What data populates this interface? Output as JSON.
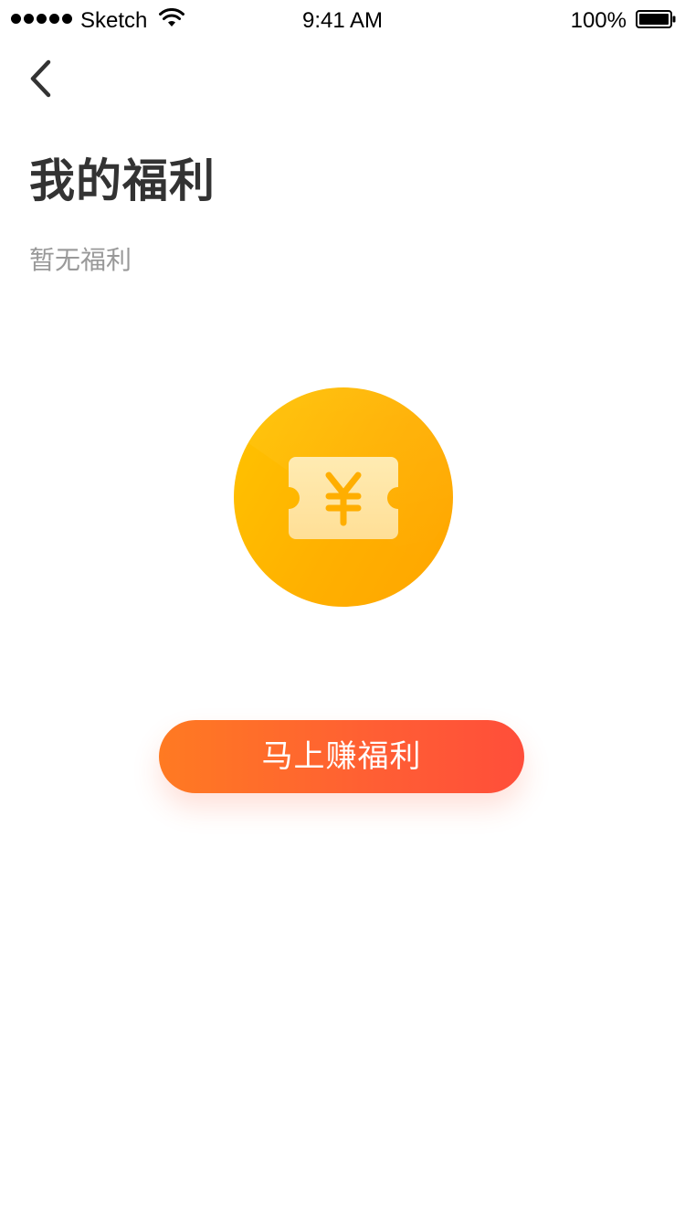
{
  "status_bar": {
    "carrier": "Sketch",
    "time": "9:41 AM",
    "battery": "100%",
    "signal_dots": 5
  },
  "header": {
    "back_icon": "chevron-left-icon",
    "title": "我的福利"
  },
  "empty_state": {
    "message": "暂无福利",
    "icon": "coupon-yen-icon",
    "colors": {
      "circle_start": "#FFC400",
      "circle_end": "#FFA500",
      "ticket": "#FFE6A6",
      "yen": "#FFAE00"
    }
  },
  "cta": {
    "label": "马上赚福利",
    "color_start": "#FF7A22",
    "color_end": "#FF4E3A"
  }
}
